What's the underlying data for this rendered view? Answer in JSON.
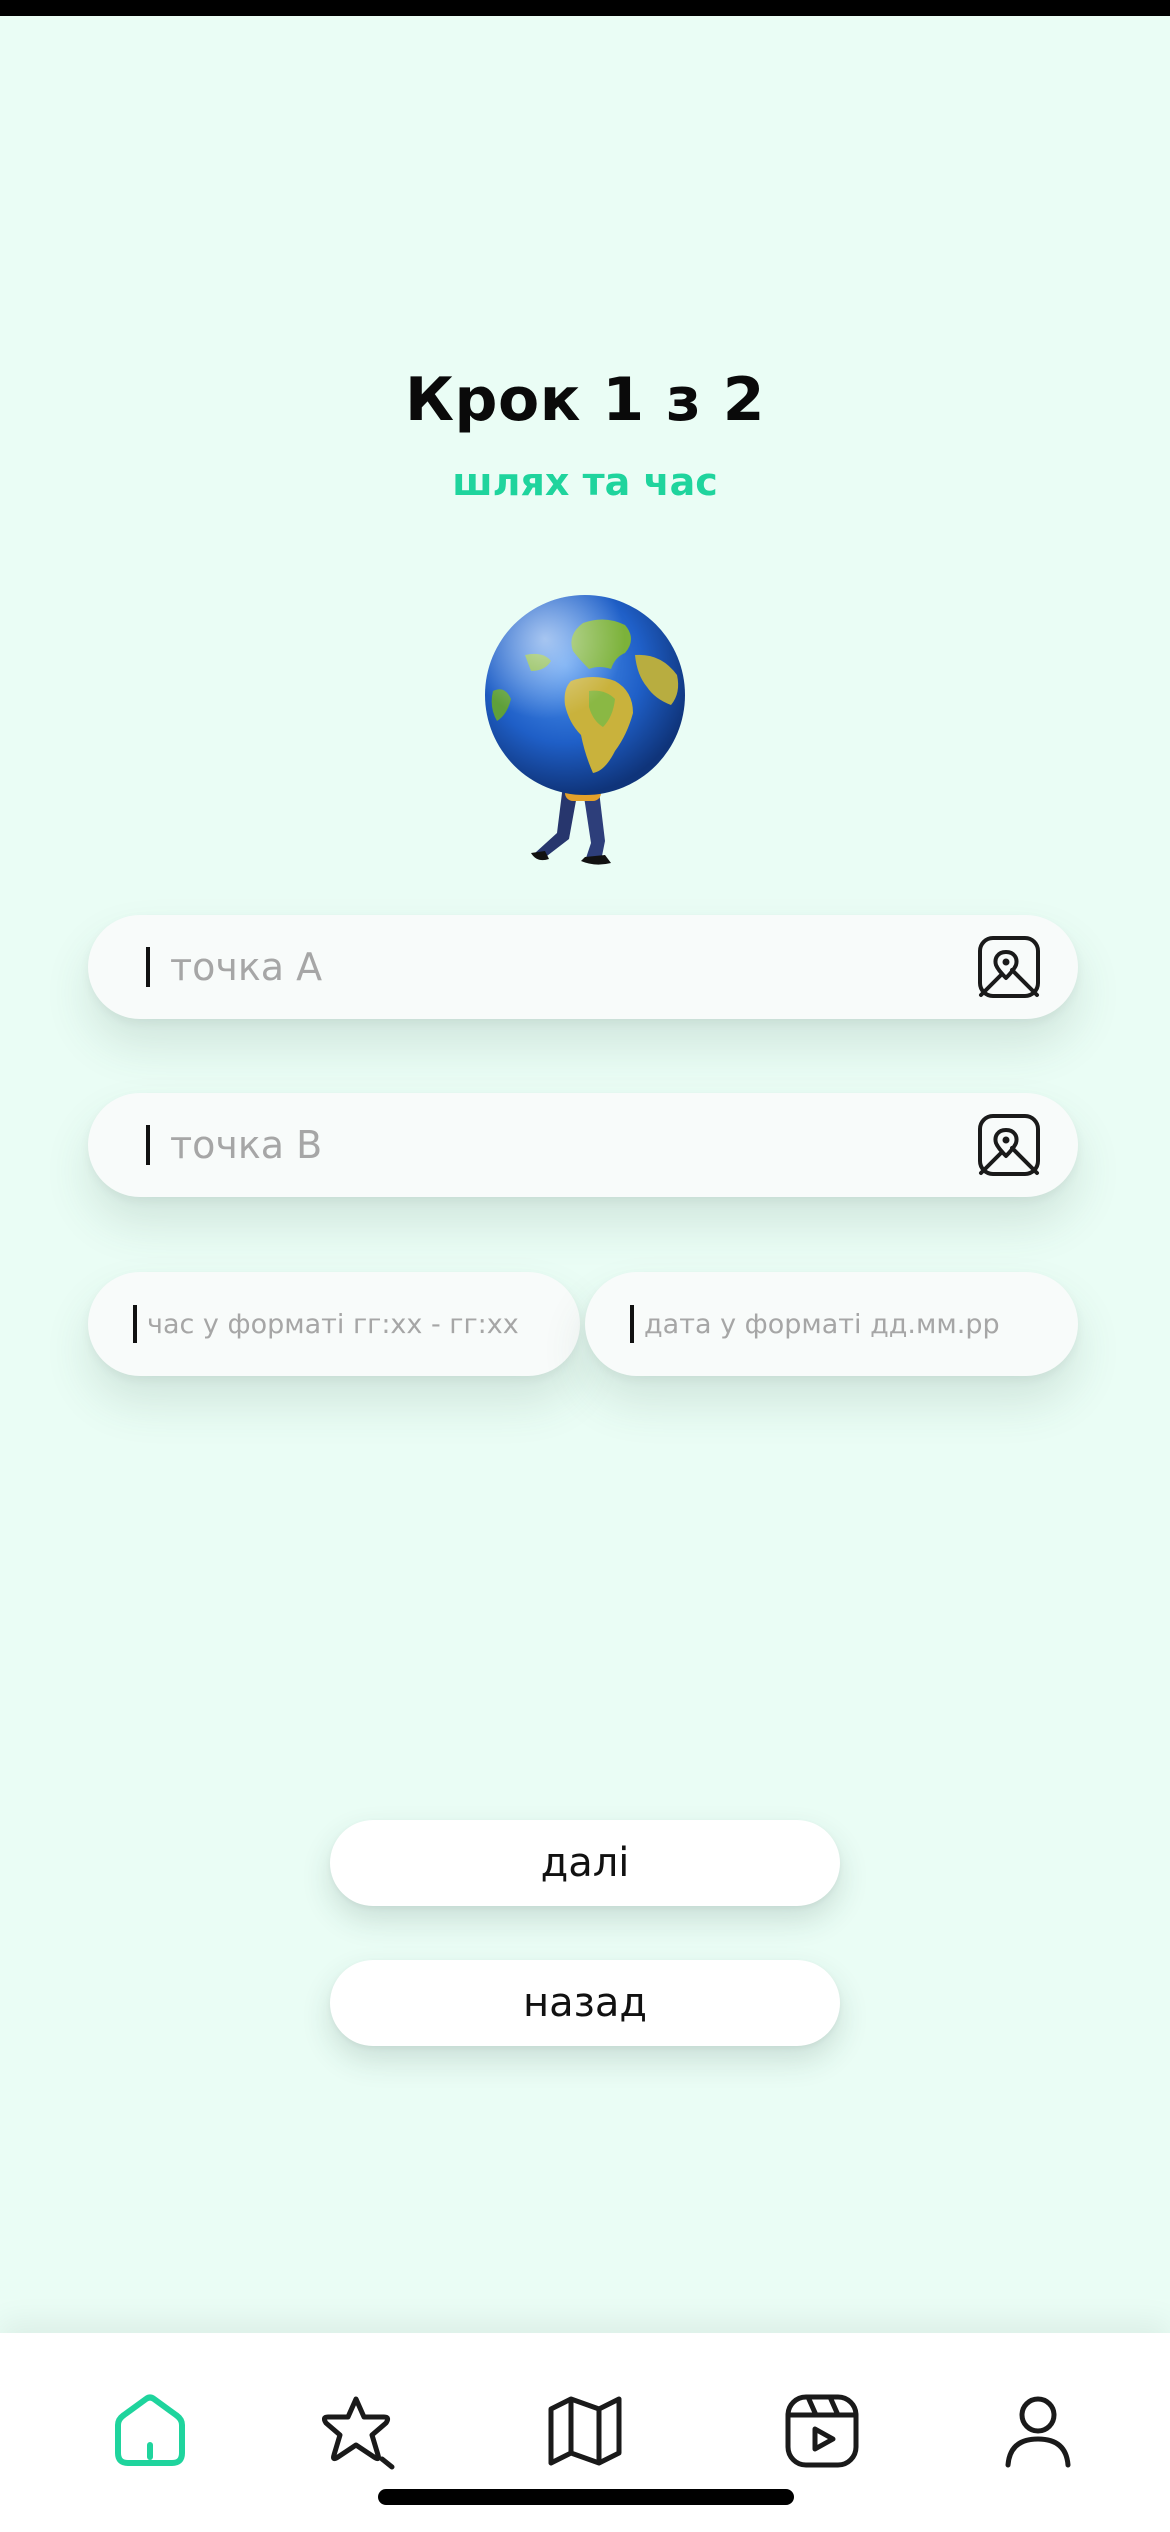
{
  "header": {
    "title": "Крок 1 з 2",
    "subtitle": "шлях та час"
  },
  "illustration": {
    "icon": "globe-carrier-icon"
  },
  "form": {
    "point_a": {
      "placeholder": "точка A",
      "value": "",
      "icon": "map-pin-icon"
    },
    "point_b": {
      "placeholder": "точка B",
      "value": "",
      "icon": "map-pin-icon"
    },
    "time": {
      "placeholder": "час у форматі гг:хх - гг:хх",
      "value": ""
    },
    "date": {
      "placeholder": "дата у форматі дд.мм.рр",
      "value": ""
    }
  },
  "actions": {
    "next_label": "далі",
    "back_label": "назад"
  },
  "tab_bar": {
    "items": [
      {
        "icon": "home-icon",
        "active": true
      },
      {
        "icon": "star-search-icon",
        "active": false
      },
      {
        "icon": "map-icon",
        "active": false
      },
      {
        "icon": "video-icon",
        "active": false
      },
      {
        "icon": "profile-icon",
        "active": false
      }
    ]
  },
  "colors": {
    "background": "#eafdf5",
    "accent": "#1fd49d",
    "text": "#0a0a0a",
    "placeholder": "#a6a6a6"
  }
}
